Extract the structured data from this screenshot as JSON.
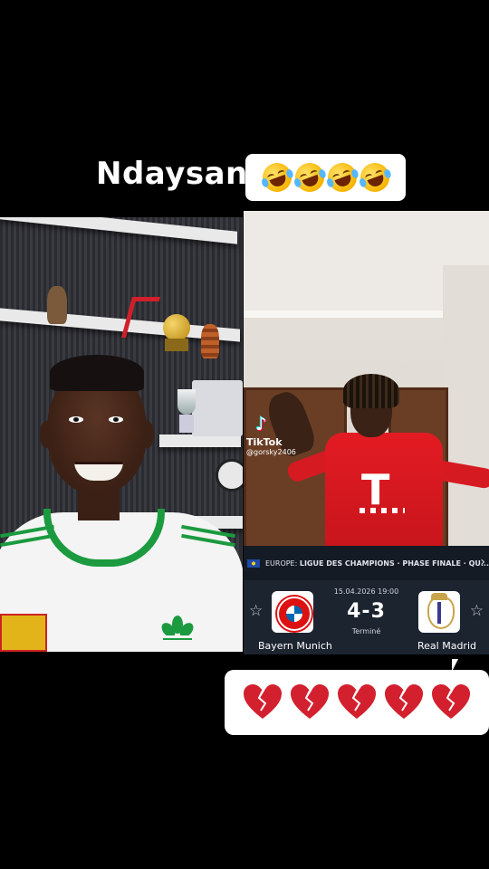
{
  "caption": {
    "title": "Ndaysan",
    "reaction_emojis": [
      "rolling-on-floor-laughing",
      "rolling-on-floor-laughing",
      "rolling-on-floor-laughing",
      "rolling-on-floor-laughing"
    ]
  },
  "overlay": {
    "brand": "TikTok",
    "handle": "@gorsky2406"
  },
  "match": {
    "competition_region": "EUROPE:",
    "competition_name": "LIGUE DES CHAMPIONS · PHASE FINALE · QU...",
    "datetime": "15.04.2026 19:00",
    "score": "4-3",
    "status": "Terminé",
    "home_team": "Bayern Munich",
    "away_team": "Real Madrid",
    "colors": {
      "bar": "#141b24",
      "card": "#1c2430"
    }
  },
  "footer": {
    "reaction_emojis": [
      "broken-heart",
      "broken-heart",
      "broken-heart",
      "broken-heart",
      "broken-heart"
    ],
    "heart_color": "#d3202e"
  },
  "jersey_text": "T"
}
